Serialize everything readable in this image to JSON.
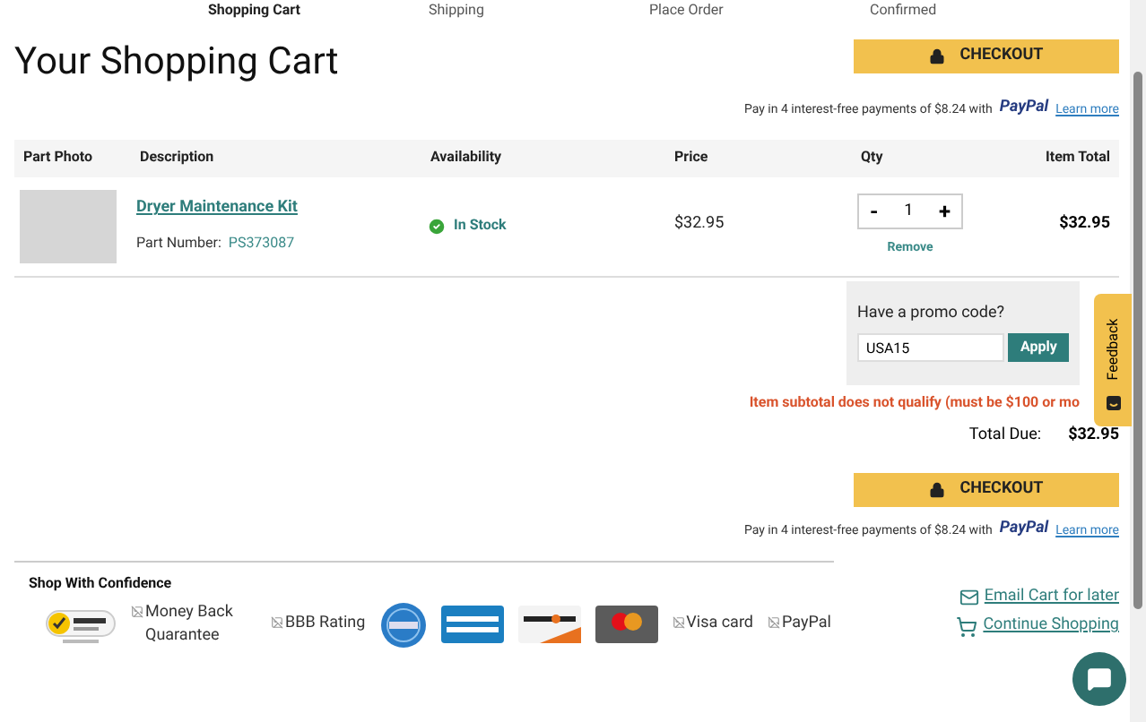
{
  "steps": [
    {
      "label": "Shopping Cart",
      "selected": true
    },
    {
      "label": "Shipping",
      "selected": false
    },
    {
      "label": "Place Order",
      "selected": false
    },
    {
      "label": "Confirmed",
      "selected": false
    }
  ],
  "title": "Your Shopping Cart",
  "checkout_button": "CHECKOUT",
  "paypal_note": {
    "text": "Pay in 4 interest-free payments of $8.24 with",
    "brand": "PayPal",
    "link": "Learn more"
  },
  "table": {
    "columns": [
      "Part Photo",
      "Description",
      "Availability",
      "Price",
      "Qty",
      "Item Total"
    ],
    "rows": [
      {
        "name": "Dryer Maintenance Kit",
        "part_label": "Part Number:",
        "part_number": "PS373087",
        "availability": "In Stock",
        "price": "$32.95",
        "qty": "1",
        "minus": "-",
        "plus": "+",
        "remove": "Remove",
        "total": "$32.95"
      }
    ]
  },
  "promo": {
    "label": "Have a promo code?",
    "value": "USA15",
    "button": "Apply"
  },
  "promo_error": "Item subtotal does not qualify (must be $100 or mo",
  "total": {
    "label": "Total Due:",
    "value": "$32.95"
  },
  "checkout_button_2": "CHECKOUT",
  "paypal_note_2": {
    "text": "Pay in 4 interest-free payments of $8.24 with",
    "brand": "PayPal",
    "link": "Learn more"
  },
  "confidence": {
    "title": "Shop With Confidence",
    "badges": [
      {
        "kind": "norton"
      },
      {
        "kind": "alt",
        "text": "Money Back Quarantee"
      },
      {
        "kind": "alt",
        "text": "BBB Rating"
      },
      {
        "kind": "bizrate"
      },
      {
        "kind": "amex"
      },
      {
        "kind": "discover"
      },
      {
        "kind": "mastercard"
      },
      {
        "kind": "alt",
        "text": "Visa card"
      },
      {
        "kind": "alt",
        "text": "PayPal"
      }
    ]
  },
  "links": [
    {
      "kind": "email",
      "label": "Email Cart for later"
    },
    {
      "kind": "cart",
      "label": "Continue Shopping"
    }
  ],
  "feedback_tab": "Feedback"
}
